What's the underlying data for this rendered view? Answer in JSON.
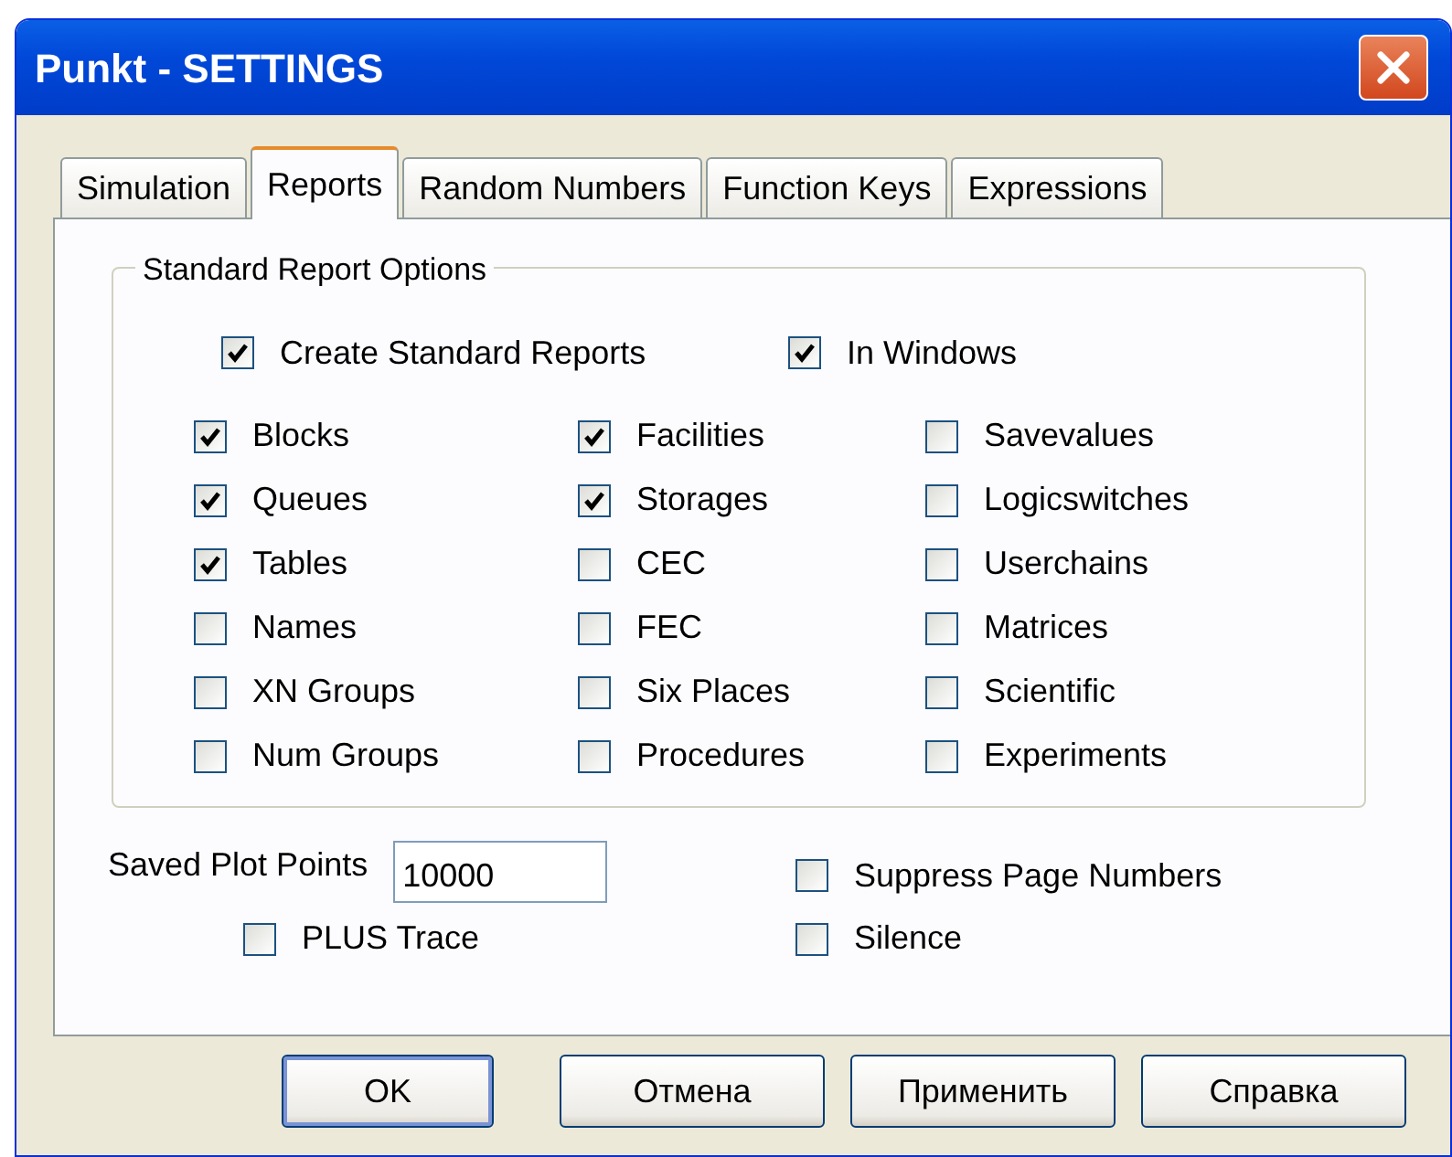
{
  "window": {
    "title": "Punkt - SETTINGS"
  },
  "tabs": [
    {
      "label": "Simulation",
      "selected": false
    },
    {
      "label": "Reports",
      "selected": true
    },
    {
      "label": "Random Numbers",
      "selected": false
    },
    {
      "label": "Function Keys",
      "selected": false
    },
    {
      "label": "Expressions",
      "selected": false
    }
  ],
  "report_options": {
    "title": "Standard Report Options",
    "top_options": [
      {
        "label": "Create Standard Reports",
        "checked": true
      },
      {
        "label": "In Windows",
        "checked": true
      }
    ],
    "options": [
      {
        "label": "Blocks",
        "checked": true
      },
      {
        "label": "Facilities",
        "checked": true
      },
      {
        "label": "Savevalues",
        "checked": false
      },
      {
        "label": "Queues",
        "checked": true
      },
      {
        "label": "Storages",
        "checked": true
      },
      {
        "label": "Logicswitches",
        "checked": false
      },
      {
        "label": "Tables",
        "checked": true
      },
      {
        "label": "CEC",
        "checked": false
      },
      {
        "label": "Userchains",
        "checked": false
      },
      {
        "label": "Names",
        "checked": false
      },
      {
        "label": "FEC",
        "checked": false
      },
      {
        "label": "Matrices",
        "checked": false
      },
      {
        "label": "XN Groups",
        "checked": false
      },
      {
        "label": "Six Places",
        "checked": false
      },
      {
        "label": "Scientific",
        "checked": false
      },
      {
        "label": "Num Groups",
        "checked": false
      },
      {
        "label": "Procedures",
        "checked": false
      },
      {
        "label": "Experiments",
        "checked": false
      }
    ]
  },
  "saved_plot_points": {
    "label": "Saved Plot Points",
    "value": "10000"
  },
  "extra_options": [
    {
      "label": "Suppress Page Numbers",
      "checked": false
    },
    {
      "label": "PLUS Trace",
      "checked": false
    },
    {
      "label": "Silence",
      "checked": false
    }
  ],
  "buttons": [
    {
      "label": "OK",
      "default": true
    },
    {
      "label": "Отмена",
      "default": false
    },
    {
      "label": "Применить",
      "default": false
    },
    {
      "label": "Справка",
      "default": false
    }
  ]
}
